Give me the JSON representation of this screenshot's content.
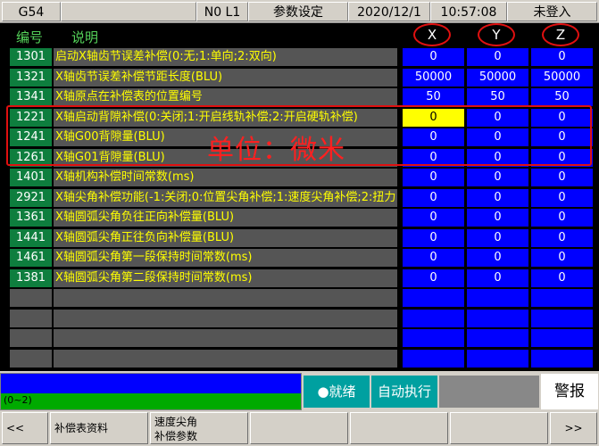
{
  "topbar": {
    "mode": "G54",
    "program": "N0 L1",
    "screen": "参数设定",
    "date": "2020/12/1",
    "time": "10:57:08",
    "login": "未登入"
  },
  "headers": {
    "id": "编号",
    "desc": "说明",
    "axes": [
      "X",
      "Y",
      "Z"
    ]
  },
  "rows": [
    {
      "id": "1301",
      "desc": "启动X轴齿节误差补偿(0:无;1:单向;2:双向)",
      "vals": [
        "0",
        "0",
        "0"
      ]
    },
    {
      "id": "1321",
      "desc": "X轴齿节误差补偿节距长度(BLU)",
      "vals": [
        "50000",
        "50000",
        "50000"
      ]
    },
    {
      "id": "1341",
      "desc": "X轴原点在补偿表的位置编号",
      "vals": [
        "50",
        "50",
        "50"
      ]
    },
    {
      "id": "1221",
      "desc": "X轴启动背隙补偿(0:关闭;1:开启线轨补偿;2:开启硬轨补偿)",
      "vals": [
        "0",
        "0",
        "0"
      ]
    },
    {
      "id": "1241",
      "desc": "X轴G00背隙量(BLU)",
      "vals": [
        "0",
        "0",
        "0"
      ]
    },
    {
      "id": "1261",
      "desc": "X轴G01背隙量(BLU)",
      "vals": [
        "0",
        "0",
        "0"
      ]
    },
    {
      "id": "1401",
      "desc": "X轴机构补偿时间常数(ms)",
      "vals": [
        "0",
        "0",
        "0"
      ]
    },
    {
      "id": "2921",
      "desc": "X轴尖角补偿功能(-1:关闭;0:位置尖角补偿;1:速度尖角补偿;2:扭力",
      "vals": [
        "0",
        "0",
        "0"
      ]
    },
    {
      "id": "1361",
      "desc": "X轴圆弧尖角负往正向补偿量(BLU)",
      "vals": [
        "0",
        "0",
        "0"
      ]
    },
    {
      "id": "1441",
      "desc": "X轴圆弧尖角正往负向补偿量(BLU)",
      "vals": [
        "0",
        "0",
        "0"
      ]
    },
    {
      "id": "1461",
      "desc": "X轴圆弧尖角第一段保持时间常数(ms)",
      "vals": [
        "0",
        "0",
        "0"
      ]
    },
    {
      "id": "1381",
      "desc": "X轴圆弧尖角第二段保持时间常数(ms)",
      "vals": [
        "0",
        "0",
        "0"
      ]
    }
  ],
  "annotation": "单位：微米",
  "status": {
    "range": "(0~2)",
    "ready": "●就绪",
    "auto": "自动执行",
    "alarm": "警报"
  },
  "softkeys": {
    "prev": "<<",
    "comp_table": "补偿表资料",
    "speed_corner_1": "速度尖角",
    "speed_corner_2": "补偿参数",
    "next": ">>"
  },
  "colors": {
    "id_cell": "#0e7e3e",
    "desc_cell": "#555555",
    "value_cell": "#0000ff",
    "selected_cell": "#ffff00",
    "annotation": "#ff2020"
  }
}
